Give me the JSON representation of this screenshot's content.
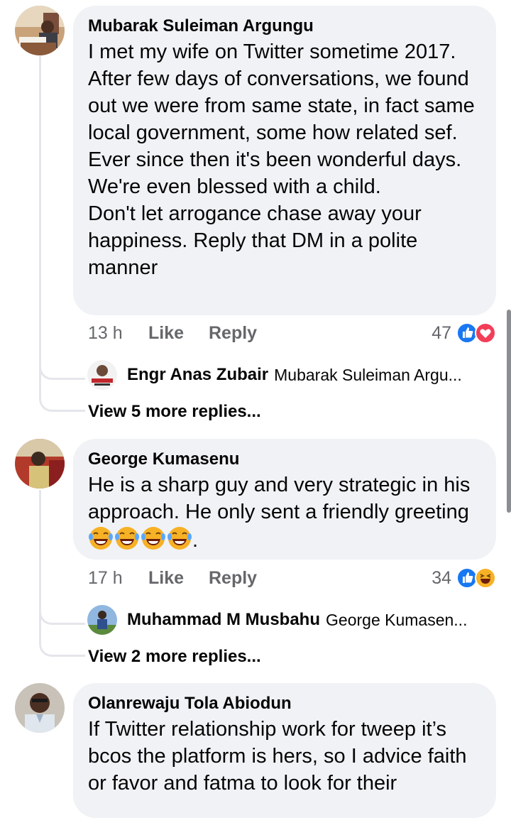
{
  "comments": [
    {
      "author": "Mubarak Suleiman Argungu",
      "text": "I met my wife on Twitter sometime 2017. After few days of conversations, we found out we were from same state, in fact same local government, some how related sef. Ever since then it's been wonderful days. We're even blessed with a child.\nDon't let arrogance chase away your happiness. Reply that DM in a polite manner",
      "time": "13 h",
      "like_label": "Like",
      "reply_label": "Reply",
      "reaction_count": "47",
      "reactions": [
        "like-icon",
        "love-icon"
      ],
      "latest_reply": {
        "author": "Engr Anas Zubair",
        "snippet": "Mubarak Suleiman Argu..."
      },
      "view_more": "View 5 more replies..."
    },
    {
      "author": "George Kumasenu",
      "text": "He is a sharp guy and very strategic in his approach. He only sent a friendly greeting",
      "text_suffix": ".",
      "emojis": [
        "laughing-crying-emoji",
        "laughing-crying-emoji",
        "laughing-crying-emoji",
        "laughing-crying-emoji"
      ],
      "time": "17 h",
      "like_label": "Like",
      "reply_label": "Reply",
      "reaction_count": "34",
      "reactions": [
        "like-icon",
        "haha-icon"
      ],
      "latest_reply": {
        "author": "Muhammad M Musbahu",
        "snippet": "George Kumasen..."
      },
      "view_more": "View 2 more replies..."
    },
    {
      "author": "Olanrewaju Tola Abiodun",
      "text": "If Twitter relationship work for tweep it’s bcos the platform is hers, so I advice faith or favor and fatma to look for their"
    }
  ],
  "colors": {
    "bubble": "#f0f2f5",
    "meta_text": "#65676b",
    "like_blue": "#1877f2",
    "love_red": "#f33e58",
    "haha_yellow": "#f7b125"
  }
}
